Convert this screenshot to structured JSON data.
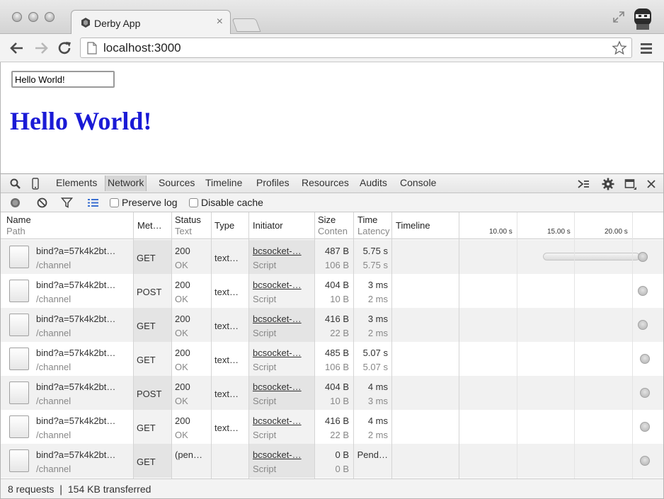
{
  "browser": {
    "tab_title": "Derby App",
    "tab_close": "×",
    "url": "localhost:3000"
  },
  "page": {
    "input_value": "Hello World!",
    "heading": "Hello World!",
    "heading_color": "#1a1ad6"
  },
  "devtools": {
    "tabs": [
      "Elements",
      "Network",
      "Sources",
      "Timeline",
      "Profiles",
      "Resources",
      "Audits",
      "Console"
    ],
    "active_tab": "Network",
    "preserve_log_label": "Preserve log",
    "disable_cache_label": "Disable cache",
    "columns": {
      "name": "Name",
      "name_sub": "Path",
      "method": "Met…",
      "status": "Status",
      "status_sub": "Text",
      "type": "Type",
      "initiator": "Initiator",
      "size": "Size",
      "size_sub": "Conten",
      "time": "Time",
      "time_sub": "Latency",
      "timeline": "Timeline"
    },
    "ticks": [
      "10.00 s",
      "15.00 s",
      "20.00 s"
    ],
    "requests": [
      {
        "name": "bind?a=57k4k2bt…",
        "path": "/channel",
        "method": "GET",
        "status": "200",
        "status_text": "OK",
        "type": "text…",
        "initiator": "bcsocket-…",
        "initiator_type": "Script",
        "size": "487 B",
        "content": "106 B",
        "time": "5.75 s",
        "latency": "5.75 s",
        "bar_start": 0.47,
        "bar_end": 0.99
      },
      {
        "name": "bind?a=57k4k2bt…",
        "path": "/channel",
        "method": "POST",
        "status": "200",
        "status_text": "OK",
        "type": "text…",
        "initiator": "bcsocket-…",
        "initiator_type": "Script",
        "size": "404 B",
        "content": "10 B",
        "time": "3 ms",
        "latency": "2 ms",
        "bar_start": 0.99,
        "bar_end": 0.99
      },
      {
        "name": "bind?a=57k4k2bt…",
        "path": "/channel",
        "method": "GET",
        "status": "200",
        "status_text": "OK",
        "type": "text…",
        "initiator": "bcsocket-…",
        "initiator_type": "Script",
        "size": "416 B",
        "content": "22 B",
        "time": "3 ms",
        "latency": "2 ms",
        "bar_start": 0.99,
        "bar_end": 0.99
      },
      {
        "name": "bind?a=57k4k2bt…",
        "path": "/channel",
        "method": "GET",
        "status": "200",
        "status_text": "OK",
        "type": "text…",
        "initiator": "bcsocket-…",
        "initiator_type": "Script",
        "size": "485 B",
        "content": "106 B",
        "time": "5.07 s",
        "latency": "5.07 s",
        "bar_start": 0.99,
        "bar_end": 1.0
      },
      {
        "name": "bind?a=57k4k2bt…",
        "path": "/channel",
        "method": "POST",
        "status": "200",
        "status_text": "OK",
        "type": "text…",
        "initiator": "bcsocket-…",
        "initiator_type": "Script",
        "size": "404 B",
        "content": "10 B",
        "time": "4 ms",
        "latency": "3 ms",
        "bar_start": 1.0,
        "bar_end": 1.0
      },
      {
        "name": "bind?a=57k4k2bt…",
        "path": "/channel",
        "method": "GET",
        "status": "200",
        "status_text": "OK",
        "type": "text…",
        "initiator": "bcsocket-…",
        "initiator_type": "Script",
        "size": "416 B",
        "content": "22 B",
        "time": "4 ms",
        "latency": "2 ms",
        "bar_start": 1.0,
        "bar_end": 1.0
      },
      {
        "name": "bind?a=57k4k2bt…",
        "path": "/channel",
        "method": "GET",
        "status": "(pen…",
        "status_text": "",
        "type": "",
        "initiator": "bcsocket-…",
        "initiator_type": "Script",
        "size": "0 B",
        "content": "0 B",
        "time": "Pend…",
        "latency": "",
        "bar_start": 1.0,
        "bar_end": 1.0
      }
    ],
    "status_bar": "8 requests ❘ 154 KB transferred"
  }
}
